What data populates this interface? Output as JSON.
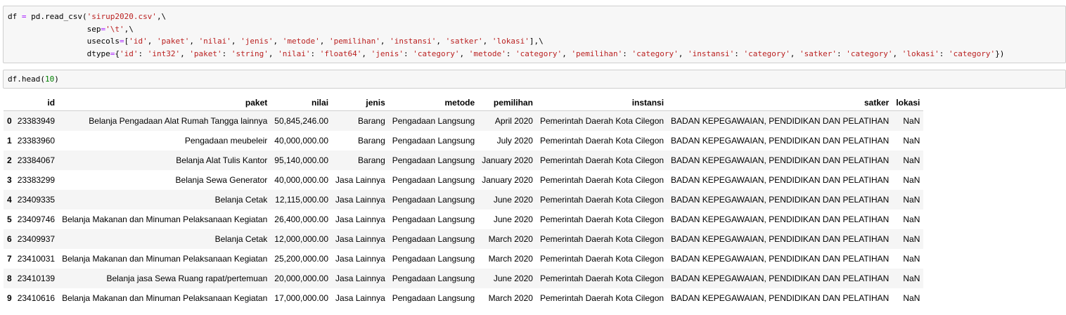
{
  "cell1": {
    "l1_a": "df ",
    "l1_eq": "=",
    "l1_b": " pd.read_csv(",
    "l1_s": "'sirup2020.csv'",
    "l1_c": ",\\",
    "l2_a": "                 sep",
    "l2_eq": "=",
    "l2_s": "'\\t'",
    "l2_c": ",\\",
    "l3_a": "                 usecols",
    "l3_eq": "=",
    "l3_b": "[",
    "l3_items": [
      "'id'",
      "'paket'",
      "'nilai'",
      "'jenis'",
      "'metode'",
      "'pemilihan'",
      "'instansi'",
      "'satker'",
      "'lokasi'"
    ],
    "l3_c": "],\\",
    "l4_a": "                 dtype",
    "l4_eq": "=",
    "l4_b": "{",
    "l4_pairs": [
      [
        "'id'",
        "'int32'"
      ],
      [
        "'paket'",
        "'string'"
      ],
      [
        "'nilai'",
        "'float64'"
      ],
      [
        "'jenis'",
        "'category'"
      ],
      [
        "'metode'",
        "'category'"
      ],
      [
        "'pemilihan'",
        "'category'"
      ],
      [
        "'instansi'",
        "'category'"
      ],
      [
        "'satker'",
        "'category'"
      ],
      [
        "'lokasi'",
        "'category'"
      ]
    ],
    "l4_c": "})"
  },
  "cell2": {
    "a": "df.head(",
    "n": "10",
    "b": ")"
  },
  "table": {
    "columns": [
      "",
      "id",
      "paket",
      "nilai",
      "jenis",
      "metode",
      "pemilihan",
      "instansi",
      "satker",
      "lokasi"
    ],
    "rows": [
      [
        "0",
        "23383949",
        "Belanja Pengadaan Alat Rumah Tangga lainnya",
        "50,845,246.00",
        "Barang",
        "Pengadaan Langsung",
        "April 2020",
        "Pemerintah Daerah Kota Cilegon",
        "BADAN KEPEGAWAIAN, PENDIDIKAN DAN PELATIHAN",
        "NaN"
      ],
      [
        "1",
        "23383960",
        "Pengadaan meubeleir",
        "40,000,000.00",
        "Barang",
        "Pengadaan Langsung",
        "July 2020",
        "Pemerintah Daerah Kota Cilegon",
        "BADAN KEPEGAWAIAN, PENDIDIKAN DAN PELATIHAN",
        "NaN"
      ],
      [
        "2",
        "23384067",
        "Belanja Alat Tulis Kantor",
        "95,140,000.00",
        "Barang",
        "Pengadaan Langsung",
        "January 2020",
        "Pemerintah Daerah Kota Cilegon",
        "BADAN KEPEGAWAIAN, PENDIDIKAN DAN PELATIHAN",
        "NaN"
      ],
      [
        "3",
        "23383299",
        "Belanja Sewa Generator",
        "40,000,000.00",
        "Jasa Lainnya",
        "Pengadaan Langsung",
        "January 2020",
        "Pemerintah Daerah Kota Cilegon",
        "BADAN KEPEGAWAIAN, PENDIDIKAN DAN PELATIHAN",
        "NaN"
      ],
      [
        "4",
        "23409335",
        "Belanja Cetak",
        "12,115,000.00",
        "Jasa Lainnya",
        "Pengadaan Langsung",
        "June 2020",
        "Pemerintah Daerah Kota Cilegon",
        "BADAN KEPEGAWAIAN, PENDIDIKAN DAN PELATIHAN",
        "NaN"
      ],
      [
        "5",
        "23409746",
        "Belanja Makanan dan Minuman Pelaksanaan Kegiatan",
        "26,400,000.00",
        "Jasa Lainnya",
        "Pengadaan Langsung",
        "June 2020",
        "Pemerintah Daerah Kota Cilegon",
        "BADAN KEPEGAWAIAN, PENDIDIKAN DAN PELATIHAN",
        "NaN"
      ],
      [
        "6",
        "23409937",
        "Belanja Cetak",
        "12,000,000.00",
        "Jasa Lainnya",
        "Pengadaan Langsung",
        "March 2020",
        "Pemerintah Daerah Kota Cilegon",
        "BADAN KEPEGAWAIAN, PENDIDIKAN DAN PELATIHAN",
        "NaN"
      ],
      [
        "7",
        "23410031",
        "Belanja Makanan dan Minuman Pelaksanaan Kegiatan",
        "25,200,000.00",
        "Jasa Lainnya",
        "Pengadaan Langsung",
        "March 2020",
        "Pemerintah Daerah Kota Cilegon",
        "BADAN KEPEGAWAIAN, PENDIDIKAN DAN PELATIHAN",
        "NaN"
      ],
      [
        "8",
        "23410139",
        "Belanja jasa Sewa Ruang rapat/pertemuan",
        "20,000,000.00",
        "Jasa Lainnya",
        "Pengadaan Langsung",
        "June 2020",
        "Pemerintah Daerah Kota Cilegon",
        "BADAN KEPEGAWAIAN, PENDIDIKAN DAN PELATIHAN",
        "NaN"
      ],
      [
        "9",
        "23410616",
        "Belanja Makanan dan Minuman Pelaksanaan Kegiatan",
        "17,000,000.00",
        "Jasa Lainnya",
        "Pengadaan Langsung",
        "March 2020",
        "Pemerintah Daerah Kota Cilegon",
        "BADAN KEPEGAWAIAN, PENDIDIKAN DAN PELATIHAN",
        "NaN"
      ]
    ]
  },
  "colors": {
    "string": "#ba2121",
    "operator": "#aa22ff",
    "number": "#008000",
    "cell_bg": "#f7f7f7",
    "stripe": "#f5f5f5"
  }
}
